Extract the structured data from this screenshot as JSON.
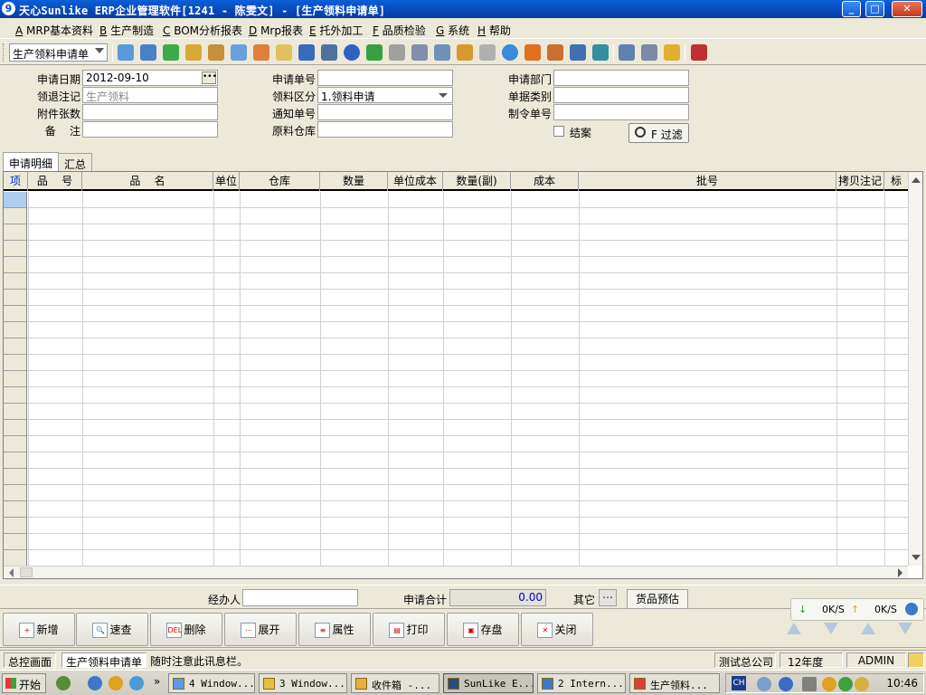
{
  "window": {
    "title": "天心Sunlike ERP企业管理软件[1241 - 陈雯文] - [生产领料申请单]"
  },
  "menu": [
    {
      "key": "A",
      "label": "MRP基本资料"
    },
    {
      "key": "B",
      "label": "生产制造"
    },
    {
      "key": "C",
      "label": "BOM分析报表"
    },
    {
      "key": "D",
      "label": "Mrp报表"
    },
    {
      "key": "E",
      "label": "托外加工"
    },
    {
      "key": "F",
      "label": "品质检验"
    },
    {
      "key": "G",
      "label": "系统"
    },
    {
      "key": "H",
      "label": "帮助"
    }
  ],
  "toolbar": {
    "bill_select": "生产领料申请单"
  },
  "form": {
    "apply_date": {
      "label": "申请日期",
      "value": "2012-09-10"
    },
    "apply_no": {
      "label": "申请单号",
      "value": ""
    },
    "apply_dept": {
      "label": "申请部门",
      "value": ""
    },
    "return_note": {
      "label": "领退注记",
      "value": "生产领料"
    },
    "pick_type": {
      "label": "领料区分",
      "value": "1.领料申请"
    },
    "doc_type": {
      "label": "单据类别",
      "value": ""
    },
    "attach_count": {
      "label": "附件张数",
      "value": ""
    },
    "notice_no": {
      "label": "通知单号",
      "value": ""
    },
    "order_no": {
      "label": "制令单号",
      "value": ""
    },
    "remark": {
      "label": "备    注",
      "value": ""
    },
    "raw_warehouse": {
      "label": "原料仓库",
      "value": ""
    },
    "closed_label": "结案",
    "filter_label": "F 过滤"
  },
  "tabs": [
    {
      "label": "申请明细",
      "active": true
    },
    {
      "label": "汇总",
      "active": false
    }
  ],
  "grid": {
    "columns": [
      "项",
      "品    号",
      "品    名",
      "单位",
      "仓库",
      "数量",
      "单位成本",
      "数量(副)",
      "成本",
      "批号",
      "拷贝注记",
      "标"
    ]
  },
  "summary": {
    "handler_label": "经办人",
    "handler_value": "",
    "total_label": "申请合计",
    "total_value": "0.00",
    "other_label": "其它",
    "estimate_label": "货品预估"
  },
  "network": {
    "down": "0K/S",
    "up": "0K/S"
  },
  "actions": [
    {
      "name": "add-button",
      "label": "新增",
      "icon": "add-icon"
    },
    {
      "name": "quick-search-button",
      "label": "速查",
      "icon": "search-icon"
    },
    {
      "name": "delete-button",
      "label": "删除",
      "icon": "delete-icon"
    },
    {
      "name": "expand-button",
      "label": "展开",
      "icon": "expand-icon"
    },
    {
      "name": "properties-button",
      "label": "属性",
      "icon": "properties-icon"
    },
    {
      "name": "print-button",
      "label": "打印",
      "icon": "printer-icon"
    },
    {
      "name": "save-button",
      "label": "存盘",
      "icon": "disk-icon"
    },
    {
      "name": "close-button",
      "label": "关闭",
      "icon": "close-icon"
    }
  ],
  "status": {
    "home": "总控画面",
    "current": "生产领料申请单",
    "message": "随时注意此讯息栏。",
    "company": "测试总公司",
    "year": "12年度",
    "user": "ADMIN"
  },
  "taskbar": {
    "start": "开始",
    "tasks": [
      "4 Window...",
      "3 Window...",
      "收件箱 -...",
      "SunLike E...",
      "2 Intern...",
      "生产领料..."
    ],
    "lang": "CH",
    "clock": "10:46"
  }
}
